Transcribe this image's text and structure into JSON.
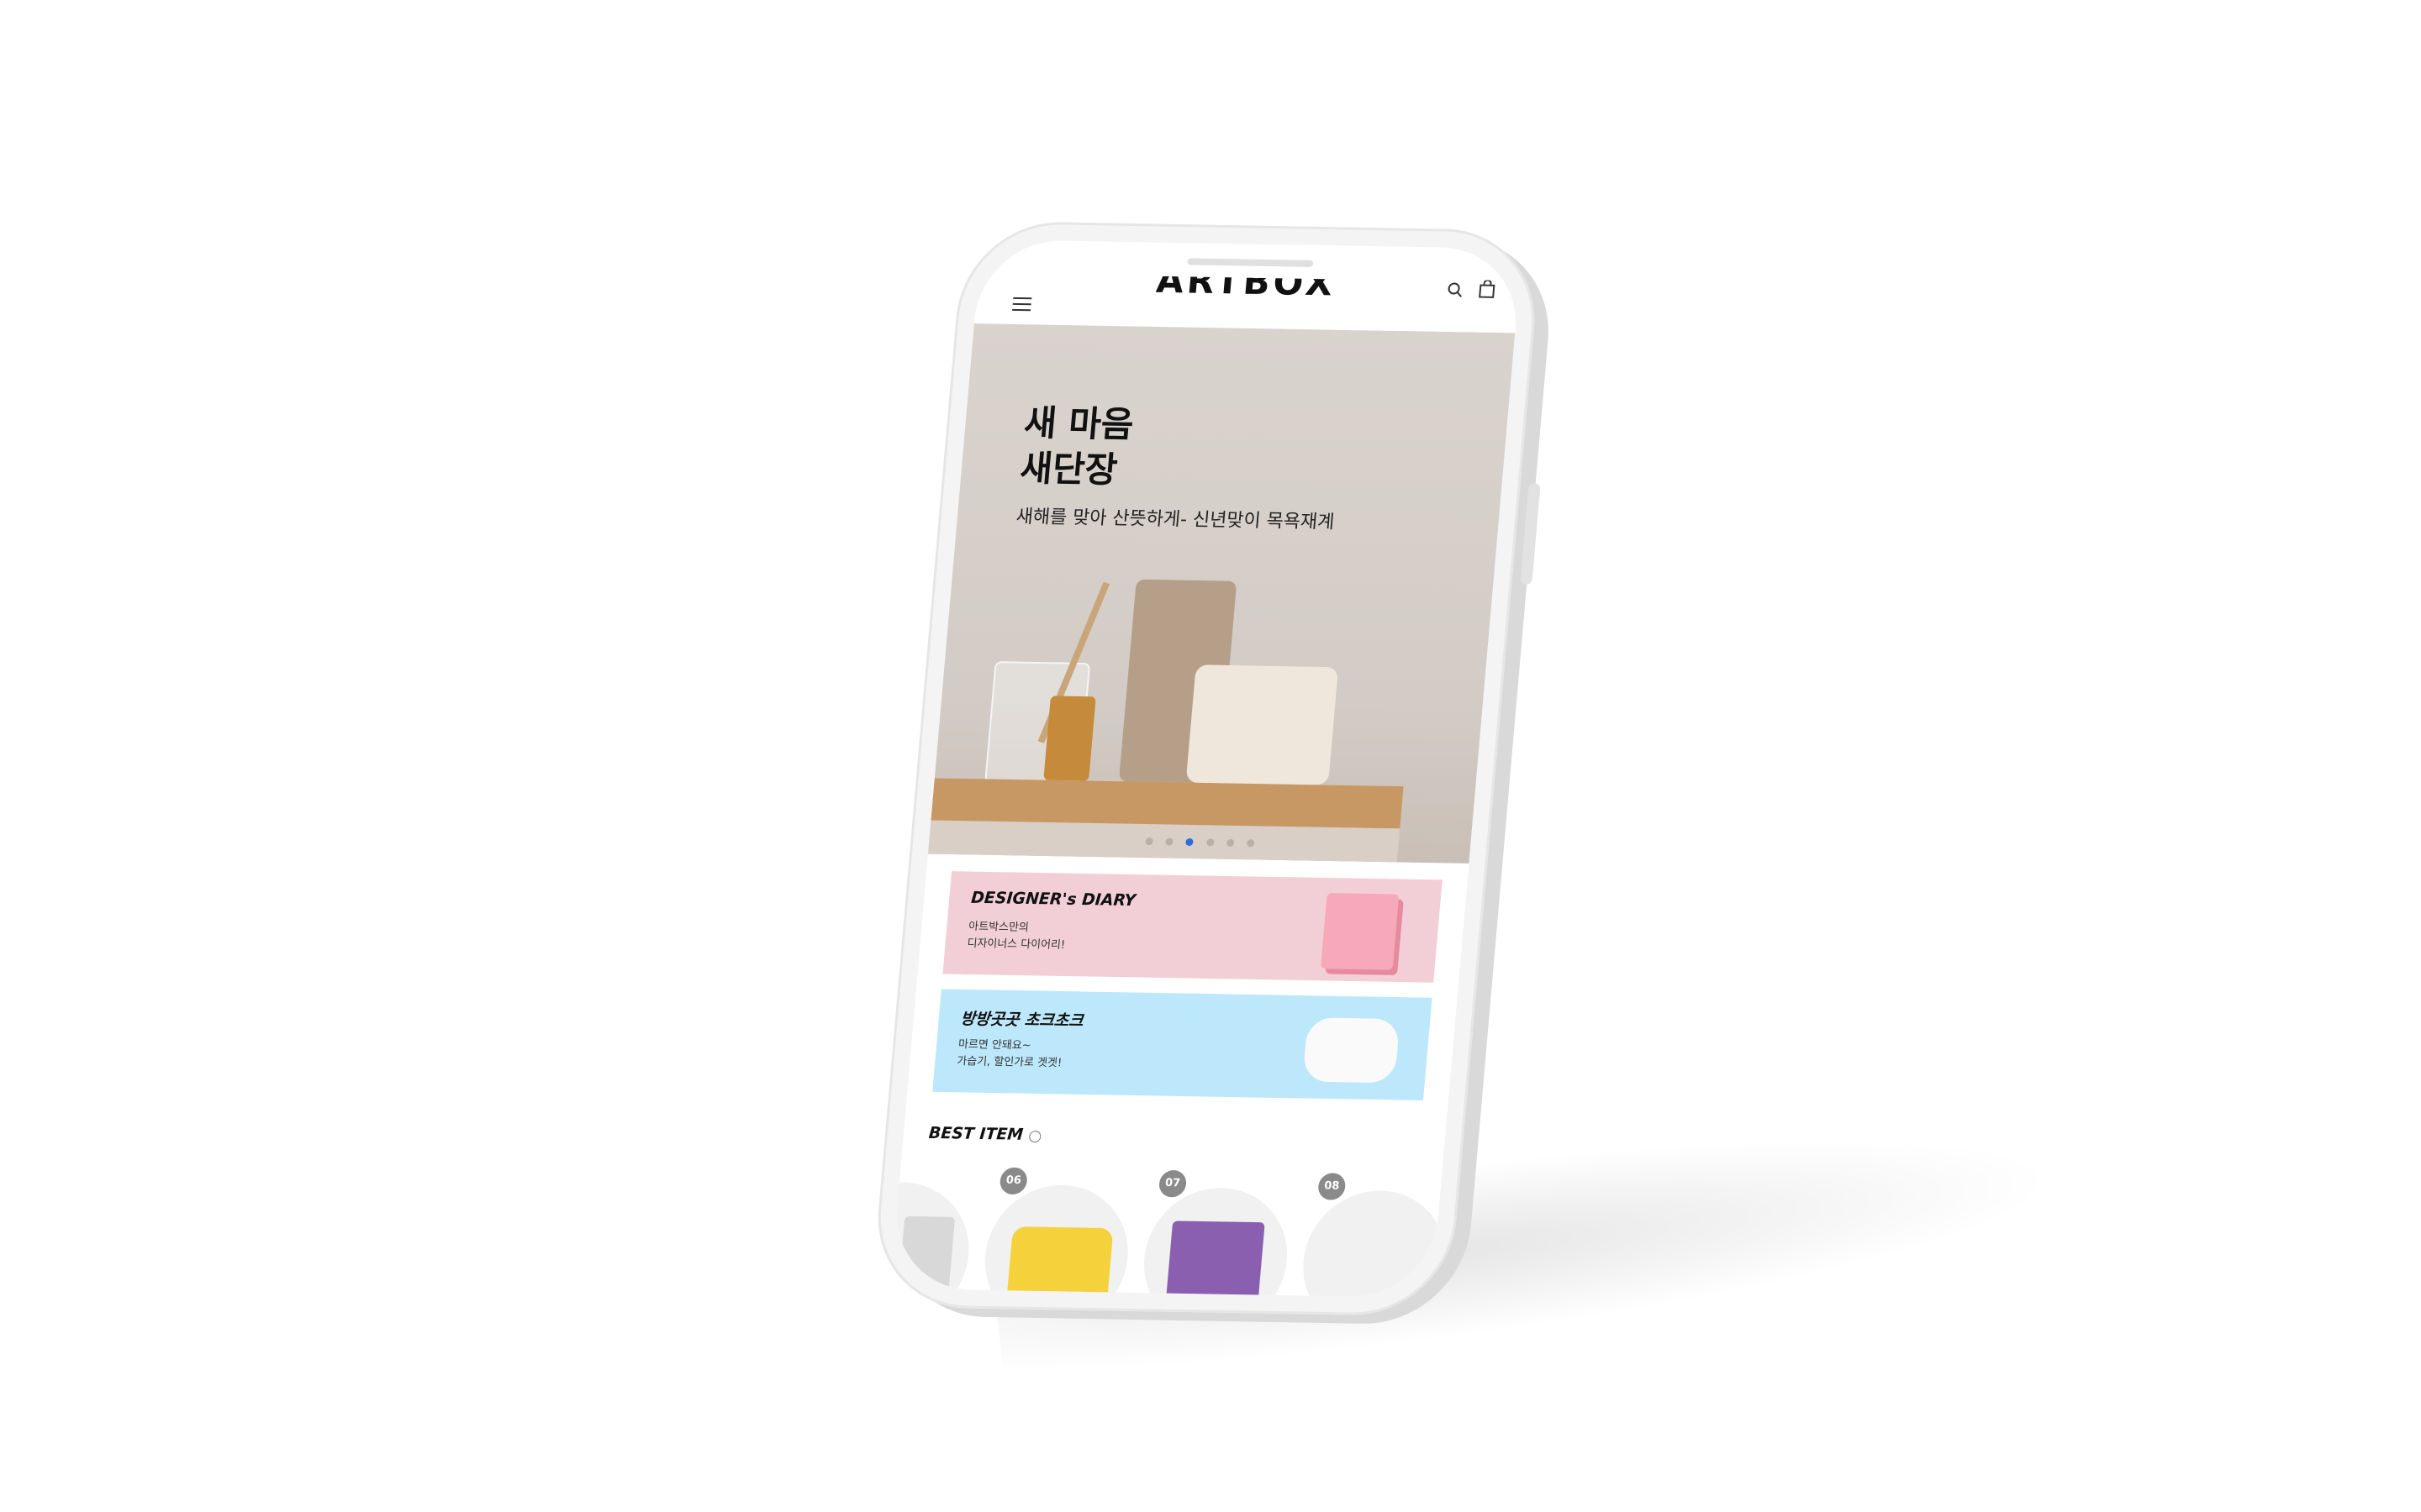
{
  "app": {
    "logo_text": "ARTBOX"
  },
  "header": {
    "menu_icon": "hamburger-menu-icon",
    "search_icon": "search-icon",
    "cart_icon": "shopping-bag-icon"
  },
  "hero": {
    "title": "새 마음\n새단장",
    "subtitle": "새해를 맞아 산뜻하게- 신년맞이 목욕재계",
    "slide_count": 6,
    "active_slide": 3
  },
  "banners": [
    {
      "title": "DESIGNER's DIARY",
      "desc": "아트박스만의\n디자이너스 다이어리!",
      "bg": "#f2cfd7"
    },
    {
      "title": "방방곳곳 초크초크",
      "desc": "마르면 안돼요~\n가습기, 할인가로 겟겟!",
      "bg": "#bde8fb"
    }
  ],
  "best": {
    "title": "BEST ITEM",
    "items": [
      {
        "rank": "06"
      },
      {
        "rank": "07"
      },
      {
        "rank": "08"
      }
    ]
  },
  "colors": {
    "accent": "#2b6fd6",
    "logo_accent": "#e0102a"
  }
}
